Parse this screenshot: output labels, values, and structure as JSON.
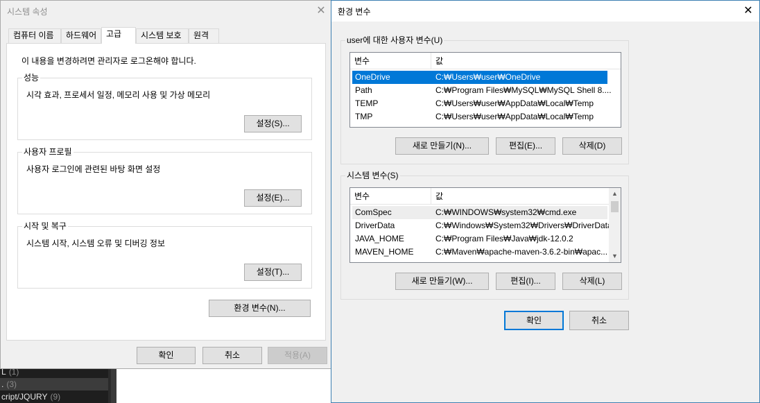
{
  "background_app": {
    "items": [
      {
        "label": "L",
        "count": "(1)"
      },
      {
        "label": ".",
        "count": "(3)"
      },
      {
        "label": "cript/JQURY",
        "count": "(9)"
      }
    ]
  },
  "sys_props": {
    "title": "시스템 속성",
    "tabs": [
      "컴퓨터 이름",
      "하드웨어",
      "고급",
      "시스템 보호",
      "원격"
    ],
    "admin_note": "이 내용을 변경하려면 관리자로 로그온해야 합니다.",
    "performance": {
      "legend": "성능",
      "desc": "시각 효과, 프로세서 일정, 메모리 사용 및 가상 메모리",
      "button": "설정(S)..."
    },
    "user_profiles": {
      "legend": "사용자 프로필",
      "desc": "사용자 로그인에 관련된 바탕 화면 설정",
      "button": "설정(E)..."
    },
    "startup": {
      "legend": "시작 및 복구",
      "desc": "시스템 시작, 시스템 오류 및 디버깅 정보",
      "button": "설정(T)..."
    },
    "env_button": "환경 변수(N)...",
    "ok": "확인",
    "cancel": "취소",
    "apply": "적용(A)"
  },
  "env_vars": {
    "title": "환경 변수",
    "user_group": {
      "legend": "user에 대한 사용자 변수(U)",
      "col_var": "변수",
      "col_val": "값",
      "rows": [
        {
          "name": "OneDrive",
          "value": "C:₩Users₩user₩OneDrive"
        },
        {
          "name": "Path",
          "value": "C:₩Program Files₩MySQL₩MySQL Shell 8...."
        },
        {
          "name": "TEMP",
          "value": "C:₩Users₩user₩AppData₩Local₩Temp"
        },
        {
          "name": "TMP",
          "value": "C:₩Users₩user₩AppData₩Local₩Temp"
        }
      ],
      "new": "새로 만들기(N)...",
      "edit": "편집(E)...",
      "delete": "삭제(D)"
    },
    "system_group": {
      "legend": "시스템 변수(S)",
      "col_var": "변수",
      "col_val": "값",
      "rows": [
        {
          "name": "ComSpec",
          "value": "C:₩WINDOWS₩system32₩cmd.exe"
        },
        {
          "name": "DriverData",
          "value": "C:₩Windows₩System32₩Drivers₩DriverData"
        },
        {
          "name": "JAVA_HOME",
          "value": "C:₩Program Files₩Java₩jdk-12.0.2"
        },
        {
          "name": "MAVEN_HOME",
          "value": "C:₩Maven₩apache-maven-3.6.2-bin₩apac..."
        }
      ],
      "new": "새로 만들기(W)...",
      "edit": "편집(I)...",
      "delete": "삭제(L)"
    },
    "ok": "확인",
    "cancel": "취소"
  },
  "icons": {
    "close": "close-icon",
    "scroll_up": "chevron-up-icon",
    "scroll_down": "chevron-down-icon"
  },
  "colors": {
    "selection": "#0078d7",
    "window_bg": "#f0f0f0",
    "panel_bg": "#ffffff"
  }
}
